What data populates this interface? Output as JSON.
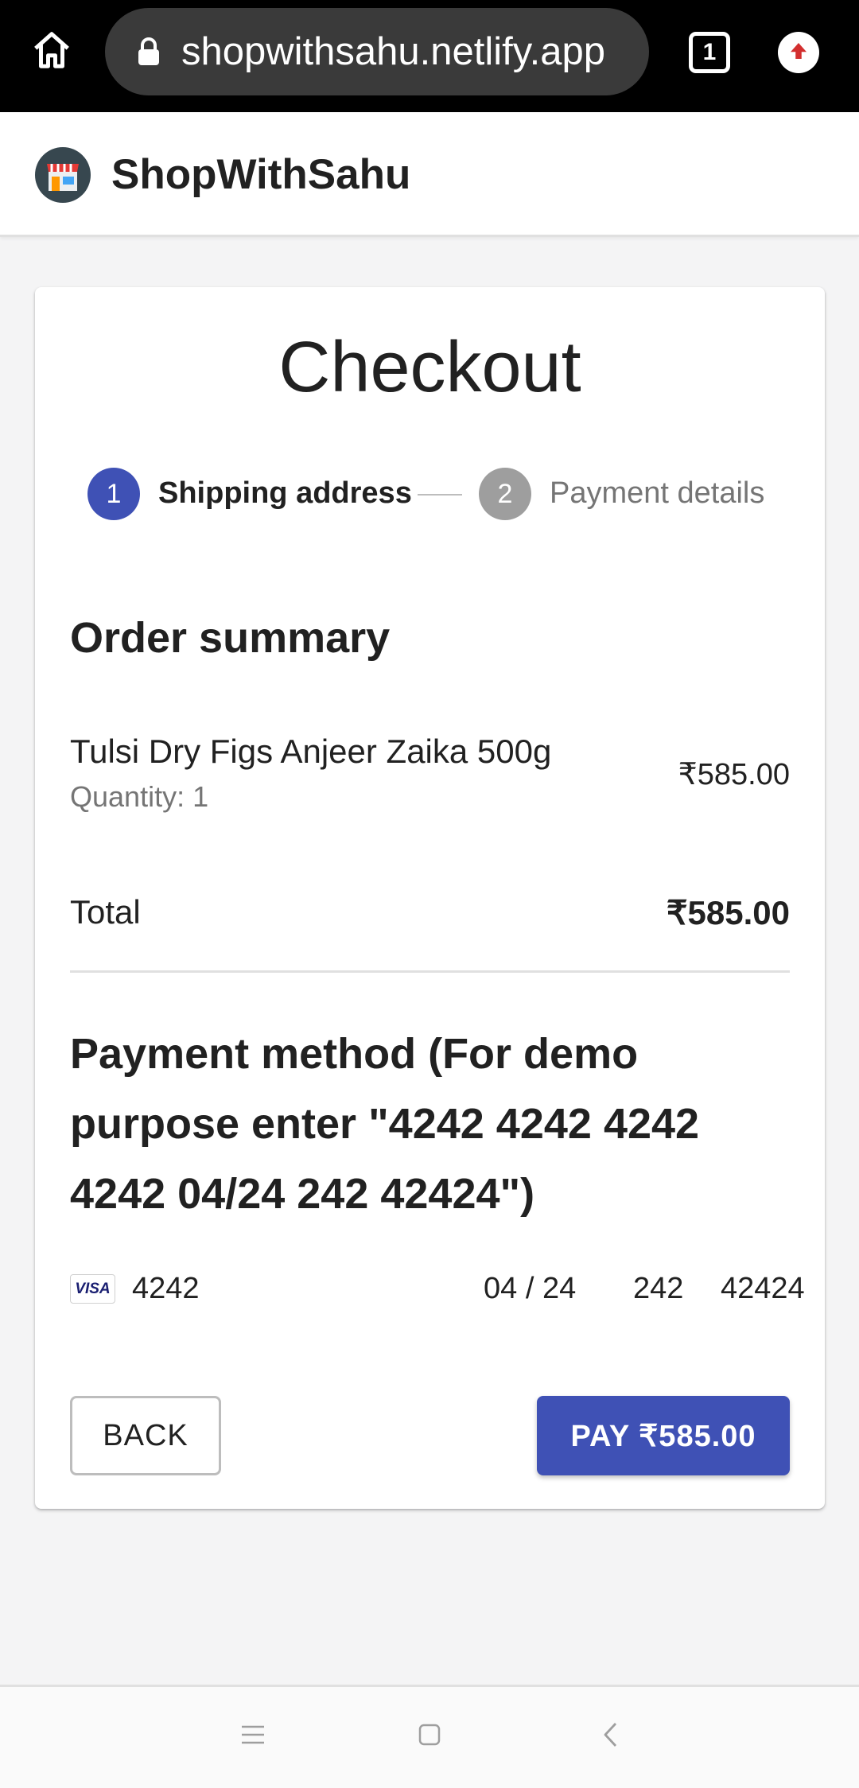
{
  "browser": {
    "url": "shopwithsahu.netlify.app",
    "tab_count": "1",
    "icons": [
      "home-icon",
      "lock-icon",
      "tabs-icon",
      "update-icon"
    ]
  },
  "header": {
    "brand": "ShopWithSahu",
    "logo_icon": "store-icon"
  },
  "checkout": {
    "title": "Checkout",
    "steps": [
      {
        "number": "1",
        "label": "Shipping address",
        "state": "active"
      },
      {
        "number": "2",
        "label": "Payment details",
        "state": "inactive"
      }
    ],
    "order_summary": {
      "title": "Order summary",
      "items": [
        {
          "name": "Tulsi Dry Figs Anjeer Zaika 500g",
          "quantity": "Quantity: 1",
          "price": "₹585.00"
        }
      ],
      "total_label": "Total",
      "total_value": "₹585.00"
    },
    "payment": {
      "title": "Payment method (For demo purpose enter \"4242 4242 4242 4242 04/24 242 42424\")",
      "card_brand": "VISA",
      "card_number": "4242",
      "expiry": "04 / 24",
      "cvc": "242",
      "zip": "42424"
    },
    "buttons": {
      "back": "BACK",
      "pay": "PAY ₹585.00"
    }
  },
  "colors": {
    "primary": "#3f51b5",
    "step_inactive": "#9e9e9e",
    "background": "#f4f4f5"
  },
  "nav_bar": {
    "icons": [
      "menu-icon",
      "home-square-icon",
      "back-chevron-icon"
    ]
  }
}
